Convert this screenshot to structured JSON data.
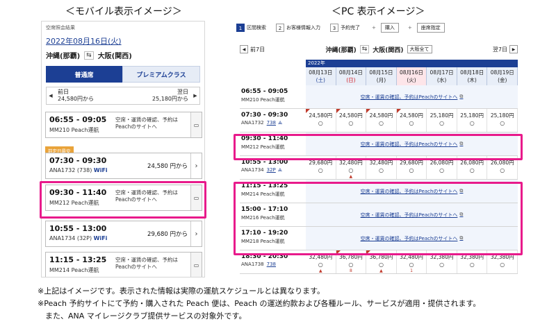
{
  "headings": {
    "mobile": "＜モバイル表示イメージ＞",
    "pc": "＜PC 表示イメージ＞"
  },
  "mobile": {
    "subtitle": "空席照会結果",
    "date": "2022年08月16日(火)",
    "origin": "沖縄(那覇)",
    "swap_icon": "⇆",
    "destination": "大阪(関西)",
    "tabs": [
      "普通席",
      "プレミアムクラス"
    ],
    "prev_label": "前日",
    "prev_price": "24,580円から",
    "next_label": "翌日",
    "next_price": "25,180円から",
    "badge": "前定日最安",
    "cards": [
      {
        "time": "06:55 - 09:05",
        "flight": "MM210  Peach運航",
        "note": "空席・運賃の確認、予約は\nPeachのサイトへ",
        "price": "",
        "side": "▭"
      },
      {
        "time": "07:30 - 09:30",
        "flight": "ANA1732  (738)",
        "wifi": "WiFi",
        "note": "",
        "price": "24,580 円から",
        "side": "›"
      },
      {
        "time": "09:30 - 11:40",
        "flight": "MM212  Peach運航",
        "note": "空席・運賃の確認、予約は\nPeachのサイトへ",
        "price": "",
        "side": "▭"
      },
      {
        "time": "10:55 - 13:00",
        "flight": "ANA1734  (32P)",
        "wifi": "WiFi",
        "note": "",
        "price": "29,680 円から",
        "side": "›"
      },
      {
        "time": "11:15 - 13:25",
        "flight": "MM214  Peach運航",
        "note": "空席・運賃の確認、予約は\nPeachのサイトへ",
        "price": "",
        "side": "▭"
      }
    ]
  },
  "pc": {
    "steps": [
      {
        "num": "1",
        "label": "区間検索",
        "active": true
      },
      {
        "num": "2",
        "label": "お客様情報入力",
        "active": false
      },
      {
        "num": "3",
        "label": "予約完了",
        "active": false
      }
    ],
    "step_extras": [
      "購入",
      "座席指定"
    ],
    "plus": "+",
    "prev_week": "前7日",
    "next_week": "翌7日",
    "origin": "沖縄(那覇)",
    "swap_icon": "⇆",
    "destination": "大阪(関西)",
    "oneway_label": "大阪全て",
    "year": "2022年",
    "dates": [
      {
        "date": "08月13日",
        "weekday": "(土)",
        "type": "sat"
      },
      {
        "date": "08月14日",
        "weekday": "(日)",
        "type": "sun"
      },
      {
        "date": "08月15日",
        "weekday": "(月)",
        "type": ""
      },
      {
        "date": "08月16日",
        "weekday": "(火)",
        "type": ""
      },
      {
        "date": "08月17日",
        "weekday": "(水)",
        "type": ""
      },
      {
        "date": "08月18日",
        "weekday": "(木)",
        "type": ""
      },
      {
        "date": "08月19日",
        "weekday": "(金)",
        "type": ""
      }
    ],
    "peach_text": "空席・運賃の確認、予約はPeachのサイトへ",
    "ext_icon": "⧉",
    "rows": [
      {
        "time": "06:55 - 09:05",
        "flight": "MM210 Peach運航",
        "merged": true
      },
      {
        "time": "07:30 - 09:30",
        "flight": "ANA1732",
        "aircraft": "738",
        "wifi": "⟁",
        "prices": [
          "24,580円",
          "24,580円",
          "24,580円",
          "24,580円",
          "25,180円",
          "25,180円",
          "25,180円"
        ],
        "marks": [
          "○",
          "○",
          "○",
          "○",
          "○",
          "○",
          "○"
        ],
        "tri": [
          true,
          true,
          true,
          true,
          false,
          false,
          false
        ],
        "subs": [
          "",
          "",
          "",
          "",
          "",
          "",
          ""
        ]
      },
      {
        "time": "09:30 - 11:40",
        "flight": "MM212 Peach運航",
        "merged": true
      },
      {
        "time": "10:55 - 13:00",
        "flight": "ANA1734",
        "aircraft": "32P",
        "wifi": "⟁",
        "prices": [
          "29,680円",
          "32,480円",
          "32,480円",
          "29,680円",
          "26,080円",
          "26,080円",
          "26,080円"
        ],
        "marks": [
          "○",
          "○",
          "○",
          "○",
          "○",
          "○",
          "○"
        ],
        "tri": [
          false,
          false,
          false,
          false,
          false,
          false,
          false
        ],
        "subs": [
          "",
          "▲",
          "",
          "",
          "",
          "",
          ""
        ]
      },
      {
        "time": "11:15 - 13:25",
        "flight": "MM214 Peach運航",
        "merged": true
      },
      {
        "time": "15:00 - 17:10",
        "flight": "MM216 Peach運航",
        "merged": true
      },
      {
        "time": "17:10 - 19:20",
        "flight": "MM218 Peach運航",
        "merged": true
      },
      {
        "time": "18:30 - 20:30",
        "flight": "ANA1738",
        "aircraft": "738",
        "wifi": "",
        "prices": [
          "32,480円",
          "36,780円",
          "36,780円",
          "32,480円",
          "32,380円",
          "32,380円",
          "32,380円"
        ],
        "marks": [
          "○",
          "○",
          "○",
          "○",
          "○",
          "○",
          "○"
        ],
        "tri": [
          false,
          true,
          true,
          false,
          false,
          false,
          false
        ],
        "subs": [
          "▲",
          "8",
          "▲",
          "1",
          "",
          "",
          ""
        ]
      }
    ]
  },
  "notes": [
    "※上記はイメージです。表示された情報は実際の運航スケジュールとは異なります。",
    "※Peach 予約サイトにて予約・購入された Peach 便は、Peach の運送約款および各種ルール、サービスが適用・提供されます。",
    "　また、ANA マイレージクラブ提供サービスの対象外です。"
  ]
}
